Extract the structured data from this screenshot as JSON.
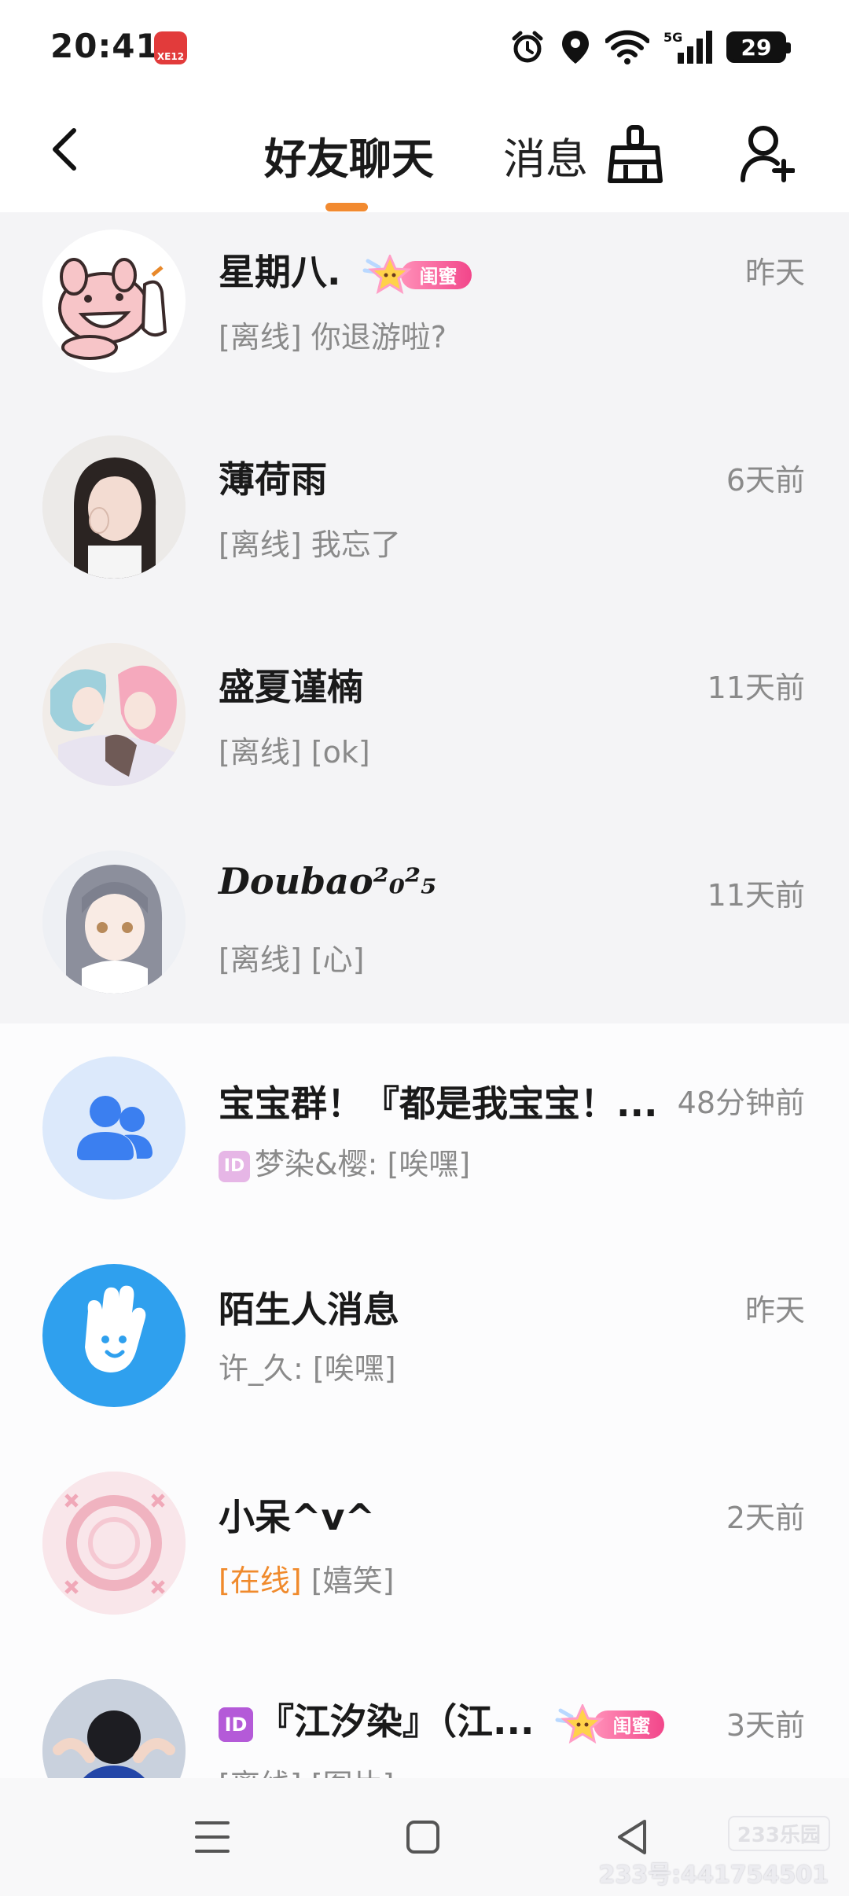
{
  "status_bar": {
    "time": "20:41",
    "app_badge": "XE12",
    "network": "5G",
    "battery": "29",
    "icons": [
      "alarm-icon",
      "location-icon",
      "wifi-icon",
      "signal-icon",
      "battery-icon"
    ]
  },
  "header": {
    "tabs": [
      {
        "label": "好友聊天",
        "active": true
      },
      {
        "label": "消息",
        "active": false
      }
    ],
    "accent_color": "#f28a30"
  },
  "conversations": [
    {
      "name": "星期八.",
      "time": "昨天",
      "status": "[离线]",
      "preview": "你退游啦?",
      "badge": "闺蜜",
      "pinned": true
    },
    {
      "name": "薄荷雨",
      "time": "6天前",
      "status": "[离线]",
      "preview": "我忘了",
      "pinned": true
    },
    {
      "name": "盛夏谨楠",
      "time": "11天前",
      "status": "[离线]",
      "preview": "[ok]",
      "pinned": true
    },
    {
      "name": "Doubao²₀²₅",
      "time": "11天前",
      "status": "[离线]",
      "preview": "[心]",
      "pinned": true
    },
    {
      "name": "宝宝群！『都是我宝宝！...",
      "time": "48分钟前",
      "id_chip": "ID",
      "preview": "梦染&樱: [唉嘿]",
      "pinned": false
    },
    {
      "name": "陌生人消息",
      "time": "昨天",
      "preview": "许_久: [唉嘿]",
      "pinned": false
    },
    {
      "name": "小呆^v^",
      "time": "2天前",
      "status": "[在线]",
      "preview": "[嬉笑]",
      "pinned": false
    },
    {
      "name": "『江汐染』（江...",
      "time": "3天前",
      "id_chip": "ID",
      "status": "[离线]",
      "preview": "[图片]",
      "badge": "闺蜜",
      "pinned": false
    }
  ],
  "watermark": {
    "logo": "233乐园",
    "user_id": "233号:441754501"
  }
}
